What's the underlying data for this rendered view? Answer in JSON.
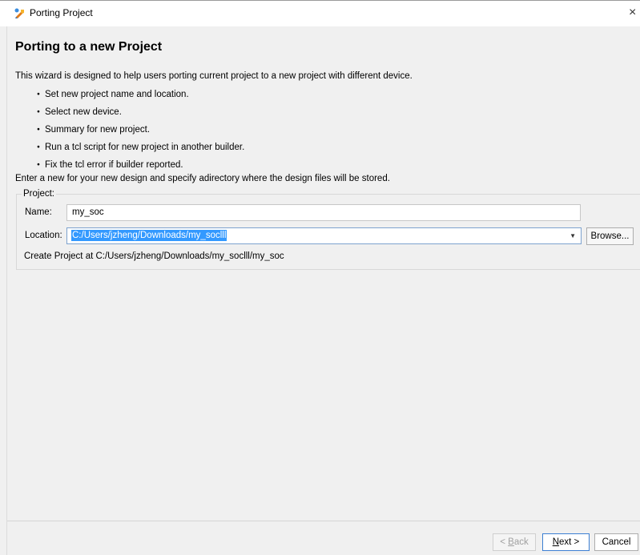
{
  "window": {
    "title": "Porting Project",
    "close_glyph": "×"
  },
  "wizard": {
    "heading": "Porting to a new Project",
    "description": "This wizard is designed to help users porting current project to a new project with different device.",
    "steps": [
      "Set new project name and location.",
      "Select new device.",
      "Summary for new project.",
      "Run a tcl script for new project in another builder.",
      "Fix the tcl error if builder reported."
    ],
    "instruction": "Enter a new for your new design and specify adirectory where the design files will be stored."
  },
  "project": {
    "group_label": "Project:",
    "name_label": "Name:",
    "name_value": "my_soc",
    "location_label": "Location:",
    "location_value": "C:/Users/jzheng/Downloads/my_soclll",
    "browse_label": "Browse...",
    "create_at": "Create Project at C:/Users/jzheng/Downloads/my_soclll/my_soc"
  },
  "buttons": {
    "back_prefix": "< ",
    "back_mnemonic": "B",
    "back_rest": "ack",
    "next_mnemonic": "N",
    "next_rest": "ext >",
    "cancel": "Cancel"
  },
  "icons": {
    "app": "tool-icon",
    "dropdown": "chevron-down-icon"
  }
}
